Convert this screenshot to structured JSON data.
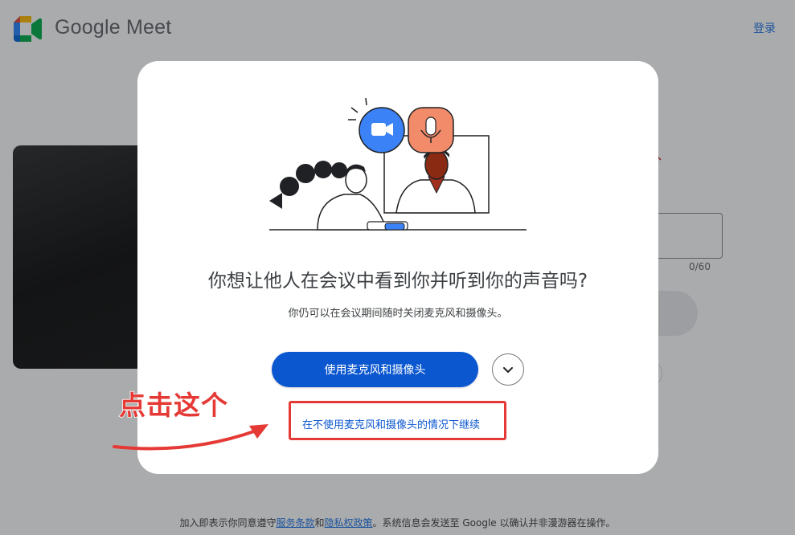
{
  "header": {
    "brand": "Google Meet",
    "signin_label": "登录"
  },
  "background": {
    "char_count": "0/60"
  },
  "dialog": {
    "title": "你想让他人在会议中看到你并听到你的声音吗?",
    "subtitle": "你仍可以在会议期间随时关闭麦克风和摄像头。",
    "primary_button": "使用麦克风和摄像头",
    "more_options_icon": "chevron-down-icon",
    "continue_without_link": "在不使用麦克风和摄像头的情况下继续"
  },
  "annotation": {
    "label": "点击这个",
    "color": "#e53935"
  },
  "footer": {
    "prefix": "加入即表示你同意遵守",
    "terms_link": "服务条款",
    "and": "和",
    "privacy_link": "隐私权政策",
    "suffix": "。系统信息会发送至 Google 以确认并非漫游器在操作。"
  },
  "colors": {
    "primary_blue": "#0b57d0",
    "link_blue": "#1a73e8",
    "camera_badge": "#3b82f6",
    "mic_badge": "#f28b6a"
  }
}
